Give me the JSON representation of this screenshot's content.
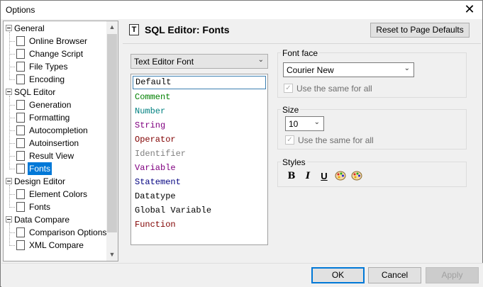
{
  "window": {
    "title": "Options",
    "close_glyph": "✕"
  },
  "tree": {
    "items": [
      {
        "label": "General",
        "level": 0,
        "icon": "expander-minus"
      },
      {
        "label": "Online Browser",
        "level": 1,
        "icon": "browser-icon"
      },
      {
        "label": "Change Script",
        "level": 1,
        "icon": "sql-script-icon"
      },
      {
        "label": "File Types",
        "level": 1,
        "icon": "file-icon"
      },
      {
        "label": "Encoding",
        "level": 1,
        "icon": "encoding-icon"
      },
      {
        "label": "SQL Editor",
        "level": 0,
        "icon": "expander-minus"
      },
      {
        "label": "Generation",
        "level": 1,
        "icon": "generation-icon"
      },
      {
        "label": "Formatting",
        "level": 1,
        "icon": "formatting-icon"
      },
      {
        "label": "Autocompletion",
        "level": 1,
        "icon": "autocompletion-icon"
      },
      {
        "label": "Autoinsertion",
        "level": 1,
        "icon": "autoinsertion-icon"
      },
      {
        "label": "Result View",
        "level": 1,
        "icon": "grid-icon"
      },
      {
        "label": "Fonts",
        "level": 1,
        "icon": "font-icon",
        "selected": true
      },
      {
        "label": "Design Editor",
        "level": 0,
        "icon": "expander-minus"
      },
      {
        "label": "Element Colors",
        "level": 1,
        "icon": "palette-icon"
      },
      {
        "label": "Fonts",
        "level": 1,
        "icon": "font-icon"
      },
      {
        "label": "Data Compare",
        "level": 0,
        "icon": "expander-minus"
      },
      {
        "label": "Comparison Options",
        "level": 1,
        "icon": "comparison-icon"
      },
      {
        "label": "XML Compare",
        "level": 1,
        "icon": "xml-compare-icon"
      }
    ]
  },
  "header": {
    "title": "SQL Editor: Fonts",
    "reset_button": "Reset to Page Defaults"
  },
  "font_category": {
    "selected": "Text Editor Font"
  },
  "font_items": [
    {
      "label": "Default",
      "color": "#000000"
    },
    {
      "label": "Comment",
      "color": "#008000"
    },
    {
      "label": "Number",
      "color": "#008080"
    },
    {
      "label": "String",
      "color": "#800080"
    },
    {
      "label": "Operator",
      "color": "#800000"
    },
    {
      "label": "Identifier",
      "color": "#808080"
    },
    {
      "label": "Variable",
      "color": "#800080"
    },
    {
      "label": "Statement",
      "color": "#000080"
    },
    {
      "label": "Datatype",
      "color": "#000000"
    },
    {
      "label": "Global Variable",
      "color": "#000000"
    },
    {
      "label": "Function",
      "color": "#800000"
    }
  ],
  "font_face": {
    "group_label": "Font face",
    "value": "Courier New",
    "same_for_all": "Use the same for all"
  },
  "size": {
    "group_label": "Size",
    "value": "10",
    "same_for_all": "Use the same for all"
  },
  "styles": {
    "group_label": "Styles",
    "bold": "B",
    "italic": "I",
    "underline": "U"
  },
  "footer": {
    "ok": "OK",
    "cancel": "Cancel",
    "apply": "Apply"
  }
}
